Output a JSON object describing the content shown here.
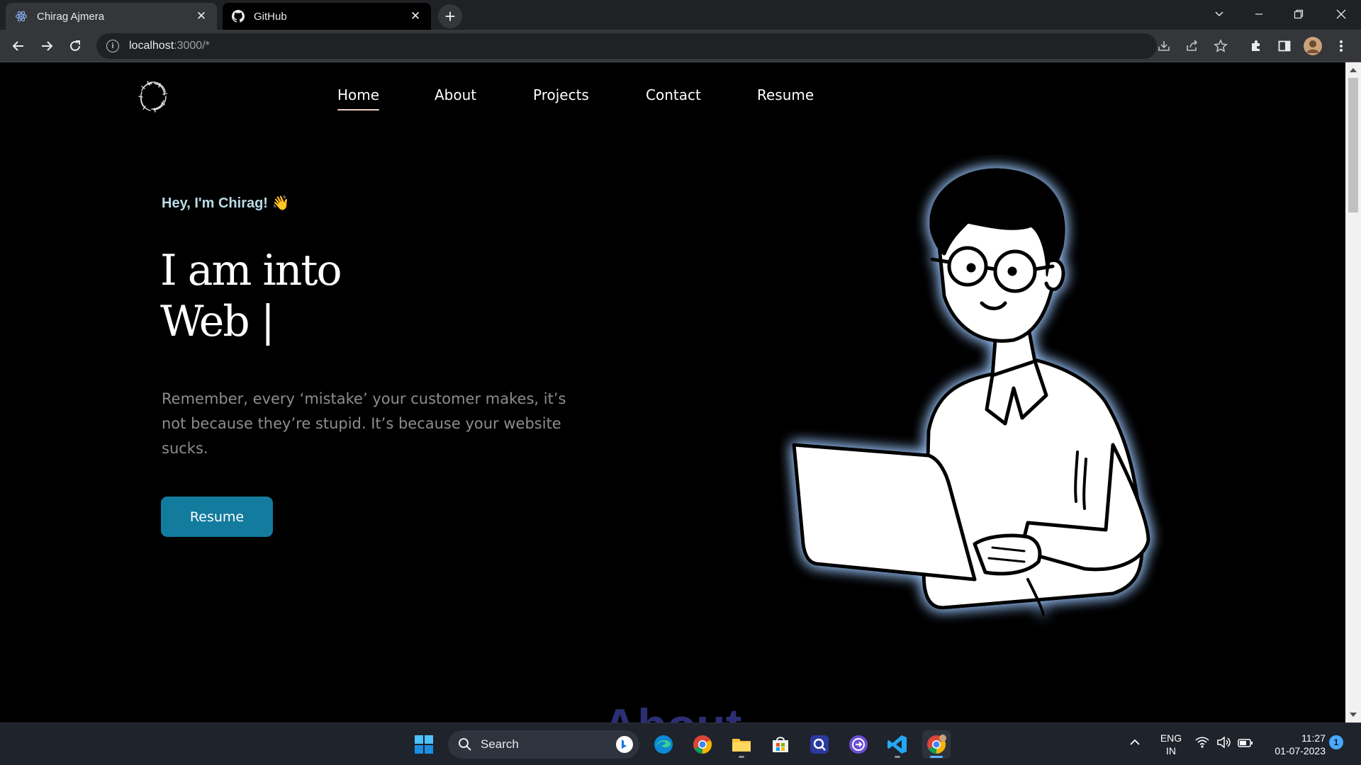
{
  "browser": {
    "tabs": [
      {
        "title": "Chirag Ajmera",
        "icon": "react-icon",
        "active": true
      },
      {
        "title": "GitHub",
        "icon": "github-icon",
        "active": false
      }
    ],
    "url_host": "localhost",
    "url_path": ":3000/*"
  },
  "nav": {
    "items": [
      {
        "label": "Home",
        "active": true
      },
      {
        "label": "About",
        "active": false
      },
      {
        "label": "Projects",
        "active": false
      },
      {
        "label": "Contact",
        "active": false
      },
      {
        "label": "Resume",
        "active": false
      }
    ]
  },
  "hero": {
    "greeting": "Hey, I'm Chirag! 👋",
    "title_line1": "I am into",
    "title_line2": "Web |",
    "description": "Remember, every ‘mistake’ your customer makes, it’s not because they’re stupid. It’s because your website sucks.",
    "button_label": "Resume",
    "button_color": "#137b9e",
    "greeting_color": "#b9dbe6"
  },
  "next_section": {
    "heading": "About"
  },
  "taskbar": {
    "search_placeholder": "Search",
    "language": "ENG",
    "region": "IN",
    "time": "11:27",
    "date": "01-07-2023",
    "notification_count": "1"
  }
}
